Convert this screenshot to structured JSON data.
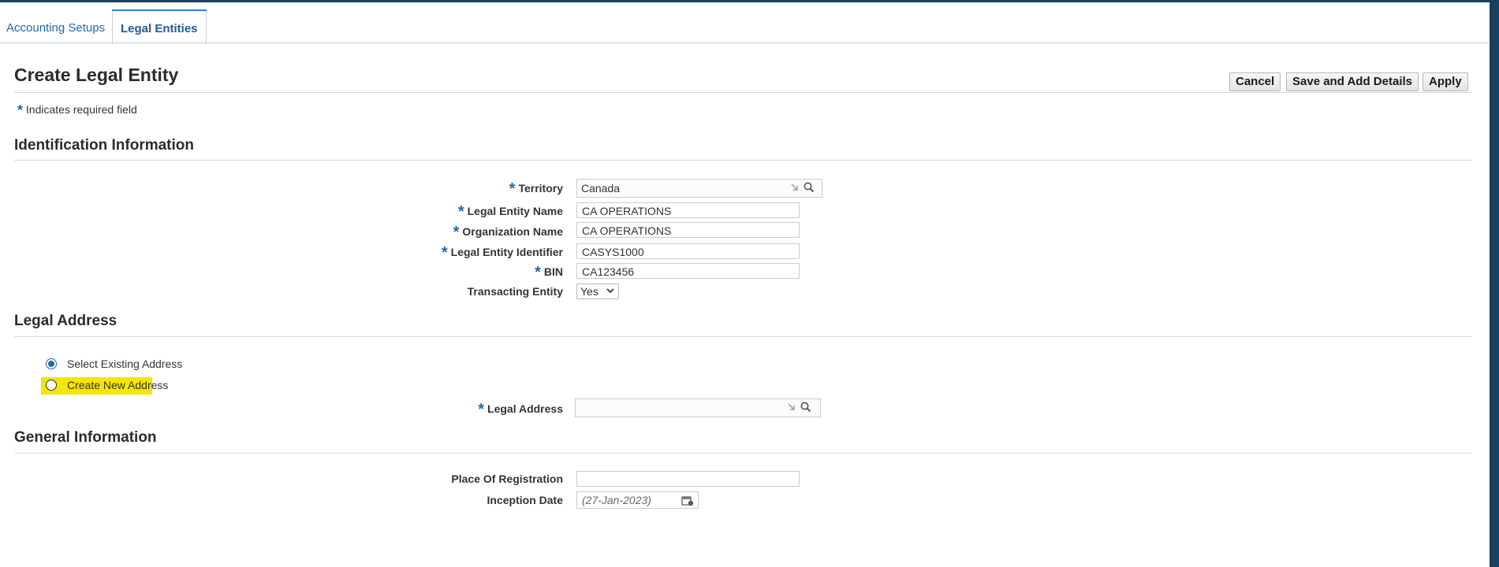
{
  "tabs": [
    {
      "label": "Accounting Setups",
      "active": false
    },
    {
      "label": "Legal Entities",
      "active": true
    }
  ],
  "page": {
    "title": "Create Legal Entity",
    "required_note": "Indicates required field",
    "required_marker": "*"
  },
  "actions": {
    "cancel_label": "Cancel",
    "save_add_label": "Save and Add Details",
    "apply_label": "Apply"
  },
  "sections": {
    "identification": "Identification Information",
    "legal_address": "Legal Address",
    "general": "General Information"
  },
  "identification": {
    "territory": {
      "label": "Territory",
      "value": "Canada",
      "required": true
    },
    "legal_entity_name": {
      "label": "Legal Entity Name",
      "value": "CA OPERATIONS",
      "required": true
    },
    "organization_name": {
      "label": "Organization Name",
      "value": "CA OPERATIONS",
      "required": true
    },
    "legal_entity_identifier": {
      "label": "Legal Entity Identifier",
      "value": "CASYS1000",
      "required": true
    },
    "bin": {
      "label": "BIN",
      "value": "CA123456",
      "required": true
    },
    "transacting_entity": {
      "label": "Transacting Entity",
      "value": "Yes",
      "required": false
    }
  },
  "legal_address": {
    "options": [
      {
        "label": "Select Existing Address",
        "selected": true
      },
      {
        "label": "Create New Address",
        "selected": false,
        "highlighted": true
      }
    ],
    "field": {
      "label": "Legal Address",
      "value": "",
      "required": true
    }
  },
  "general": {
    "place_of_registration": {
      "label": "Place Of Registration",
      "value": ""
    },
    "inception_date": {
      "label": "Inception Date",
      "placeholder": "(27-Jan-2023)"
    }
  },
  "colors": {
    "brand_dark": "#1b3f5e",
    "link_blue": "#1f6aa8",
    "highlight_yellow": "#f4e600"
  },
  "icons": {
    "lov_search": "magnifier-icon",
    "lov_arrow": "diagonal-arrow-icon",
    "calendar": "calendar-icon",
    "dropdown": "chevron-down-icon"
  }
}
